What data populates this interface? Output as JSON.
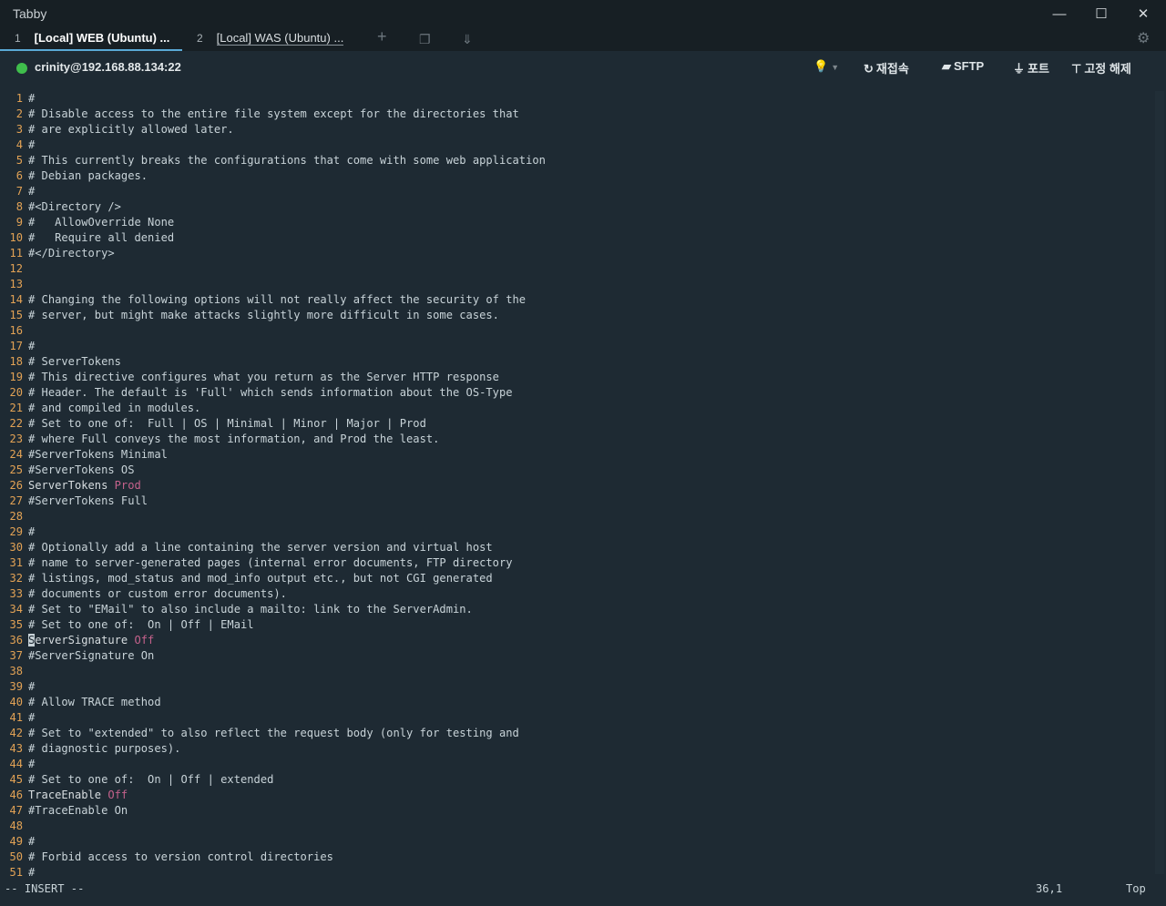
{
  "app": {
    "title": "Tabby"
  },
  "window": {
    "minimize": "—",
    "maximize": "☐",
    "close": "✕"
  },
  "tabs": [
    {
      "index": "1",
      "label": "[Local] WEB (Ubuntu) ..."
    },
    {
      "index": "2",
      "label": "[Local] WAS (Ubuntu) ..."
    }
  ],
  "tab_icons": {
    "add": "+",
    "split": "❐",
    "download": "⇓",
    "settings": "⚙"
  },
  "session": {
    "host": "crinity@192.168.88.134:22",
    "bulb_icon": "💡",
    "reconnect_label": "재접속",
    "sftp_label": "SFTP",
    "ports_label": "포트",
    "pin_label": "고정 해제"
  },
  "editor": {
    "lines": [
      {
        "n": "1",
        "t": "#"
      },
      {
        "n": "2",
        "t": "# Disable access to the entire file system except for the directories that"
      },
      {
        "n": "3",
        "t": "# are explicitly allowed later."
      },
      {
        "n": "4",
        "t": "#"
      },
      {
        "n": "5",
        "t": "# This currently breaks the configurations that come with some web application"
      },
      {
        "n": "6",
        "t": "# Debian packages."
      },
      {
        "n": "7",
        "t": "#"
      },
      {
        "n": "8",
        "t": "#<Directory />"
      },
      {
        "n": "9",
        "t": "#   AllowOverride None"
      },
      {
        "n": "10",
        "t": "#   Require all denied"
      },
      {
        "n": "11",
        "t": "#</Directory>"
      },
      {
        "n": "12",
        "t": ""
      },
      {
        "n": "13",
        "t": ""
      },
      {
        "n": "14",
        "t": "# Changing the following options will not really affect the security of the"
      },
      {
        "n": "15",
        "t": "# server, but might make attacks slightly more difficult in some cases."
      },
      {
        "n": "16",
        "t": ""
      },
      {
        "n": "17",
        "t": "#"
      },
      {
        "n": "18",
        "t": "# ServerTokens"
      },
      {
        "n": "19",
        "t": "# This directive configures what you return as the Server HTTP response"
      },
      {
        "n": "20",
        "t": "# Header. The default is 'Full' which sends information about the OS-Type"
      },
      {
        "n": "21",
        "t": "# and compiled in modules."
      },
      {
        "n": "22",
        "t": "# Set to one of:  Full | OS | Minimal | Minor | Major | Prod"
      },
      {
        "n": "23",
        "t": "# where Full conveys the most information, and Prod the least."
      },
      {
        "n": "24",
        "t": "#ServerTokens Minimal"
      },
      {
        "n": "25",
        "t": "#ServerTokens OS"
      },
      {
        "n": "26",
        "k": "ServerTokens",
        "v": "Prod"
      },
      {
        "n": "27",
        "t": "#ServerTokens Full"
      },
      {
        "n": "28",
        "t": ""
      },
      {
        "n": "29",
        "t": "#"
      },
      {
        "n": "30",
        "t": "# Optionally add a line containing the server version and virtual host"
      },
      {
        "n": "31",
        "t": "# name to server-generated pages (internal error documents, FTP directory"
      },
      {
        "n": "32",
        "t": "# listings, mod_status and mod_info output etc., but not CGI generated"
      },
      {
        "n": "33",
        "t": "# documents or custom error documents)."
      },
      {
        "n": "34",
        "t": "# Set to \"EMail\" to also include a mailto: link to the ServerAdmin."
      },
      {
        "n": "35",
        "t": "# Set to one of:  On | Off | EMail"
      },
      {
        "n": "36",
        "c": "S",
        "k": "erverSignature",
        "v": "Off"
      },
      {
        "n": "37",
        "t": "#ServerSignature On"
      },
      {
        "n": "38",
        "t": ""
      },
      {
        "n": "39",
        "t": "#"
      },
      {
        "n": "40",
        "t": "# Allow TRACE method"
      },
      {
        "n": "41",
        "t": "#"
      },
      {
        "n": "42",
        "t": "# Set to \"extended\" to also reflect the request body (only for testing and"
      },
      {
        "n": "43",
        "t": "# diagnostic purposes)."
      },
      {
        "n": "44",
        "t": "#"
      },
      {
        "n": "45",
        "t": "# Set to one of:  On | Off | extended"
      },
      {
        "n": "46",
        "k": "TraceEnable",
        "v": "Off"
      },
      {
        "n": "47",
        "t": "#TraceEnable On"
      },
      {
        "n": "48",
        "t": ""
      },
      {
        "n": "49",
        "t": "#"
      },
      {
        "n": "50",
        "t": "# Forbid access to version control directories"
      },
      {
        "n": "51",
        "t": "#"
      }
    ]
  },
  "status": {
    "mode": "-- INSERT --",
    "cursor": "36,1",
    "position": "Top"
  }
}
